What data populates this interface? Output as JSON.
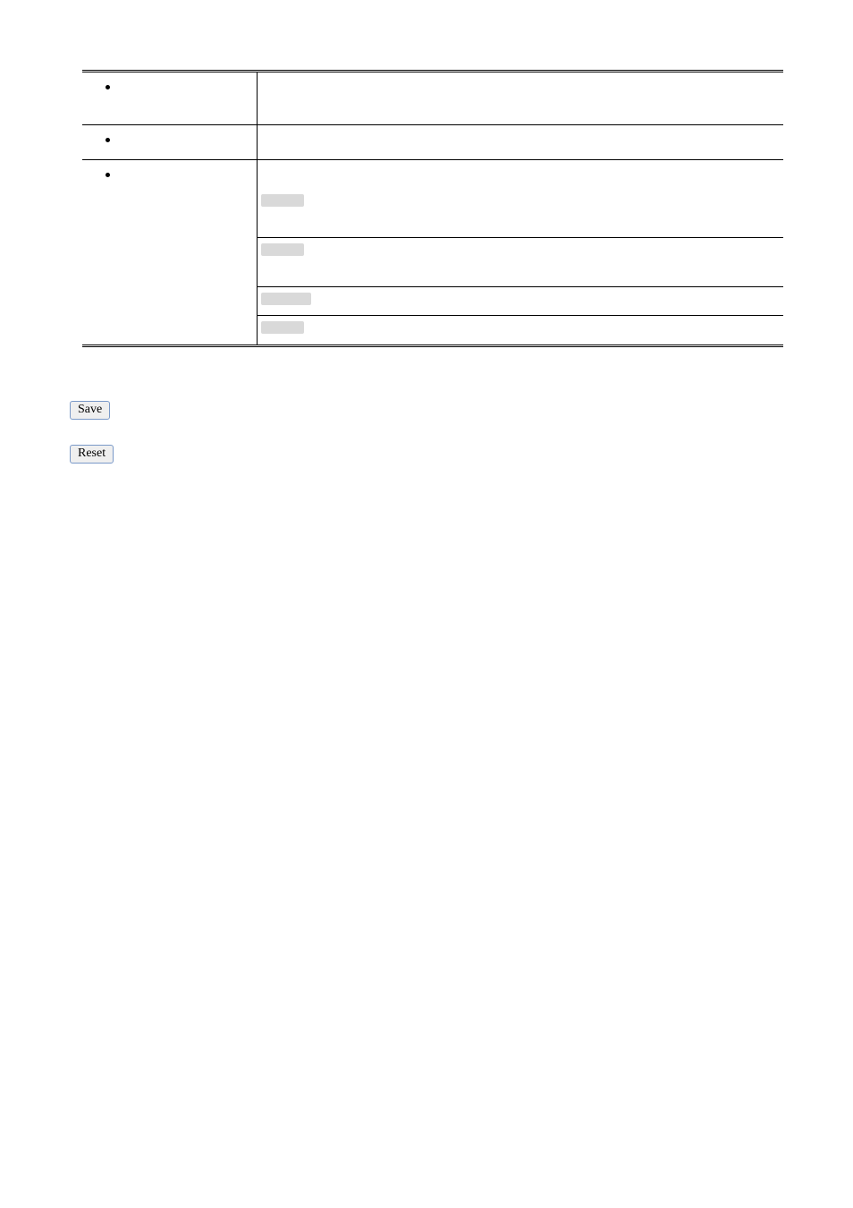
{
  "buttons": {
    "save": "Save",
    "reset": "Reset"
  },
  "rows": {
    "row1_left": "",
    "row1_right": "",
    "row2_left": "",
    "row2_right": "",
    "row3_left": "",
    "row3_right_top": "",
    "sub1": "",
    "sub2": "",
    "sub3": "",
    "sub4": ""
  }
}
